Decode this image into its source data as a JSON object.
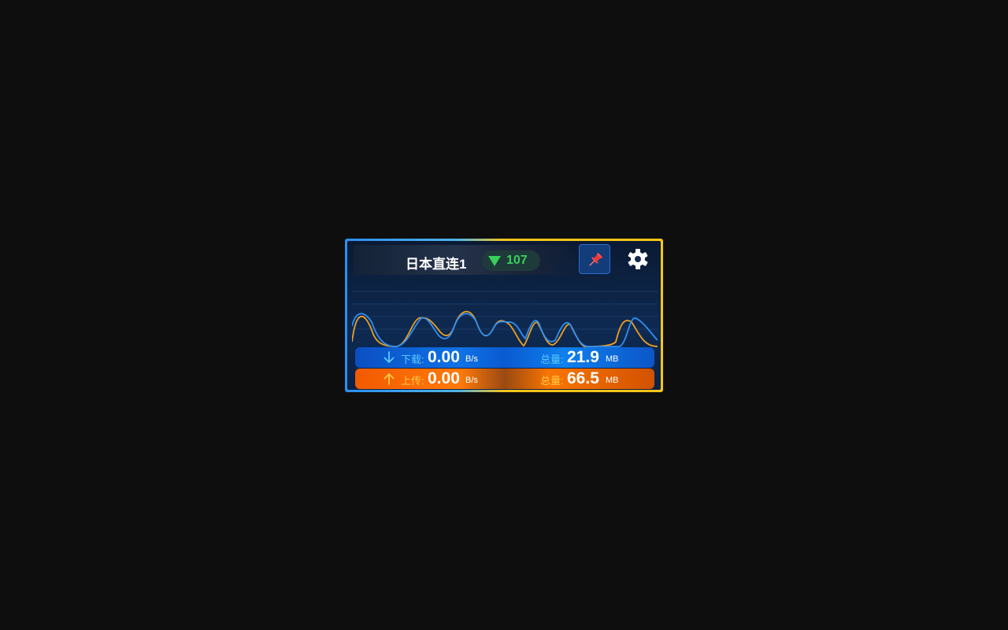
{
  "header": {
    "node_name": "日本直连1",
    "ping": "107",
    "ping_icon": "signal-triangle-icon",
    "pin_icon": "pushpin-icon",
    "settings_icon": "gear-icon"
  },
  "download": {
    "label": "下载:",
    "speed": "0.00",
    "speed_unit": "B/s",
    "total_label": "总量:",
    "total": "21.9",
    "total_unit": "MB",
    "icon": "arrow-down-icon"
  },
  "upload": {
    "label": "上传:",
    "speed": "0.00",
    "speed_unit": "B/s",
    "total_label": "总量:",
    "total": "66.5",
    "total_unit": "MB",
    "icon": "arrow-up-icon"
  },
  "colors": {
    "download_line": "#2f8ff0",
    "upload_line": "#f0a020",
    "ping_green": "#37d05a",
    "border_left": "#2a8ff0",
    "border_right": "#f5c518"
  }
}
